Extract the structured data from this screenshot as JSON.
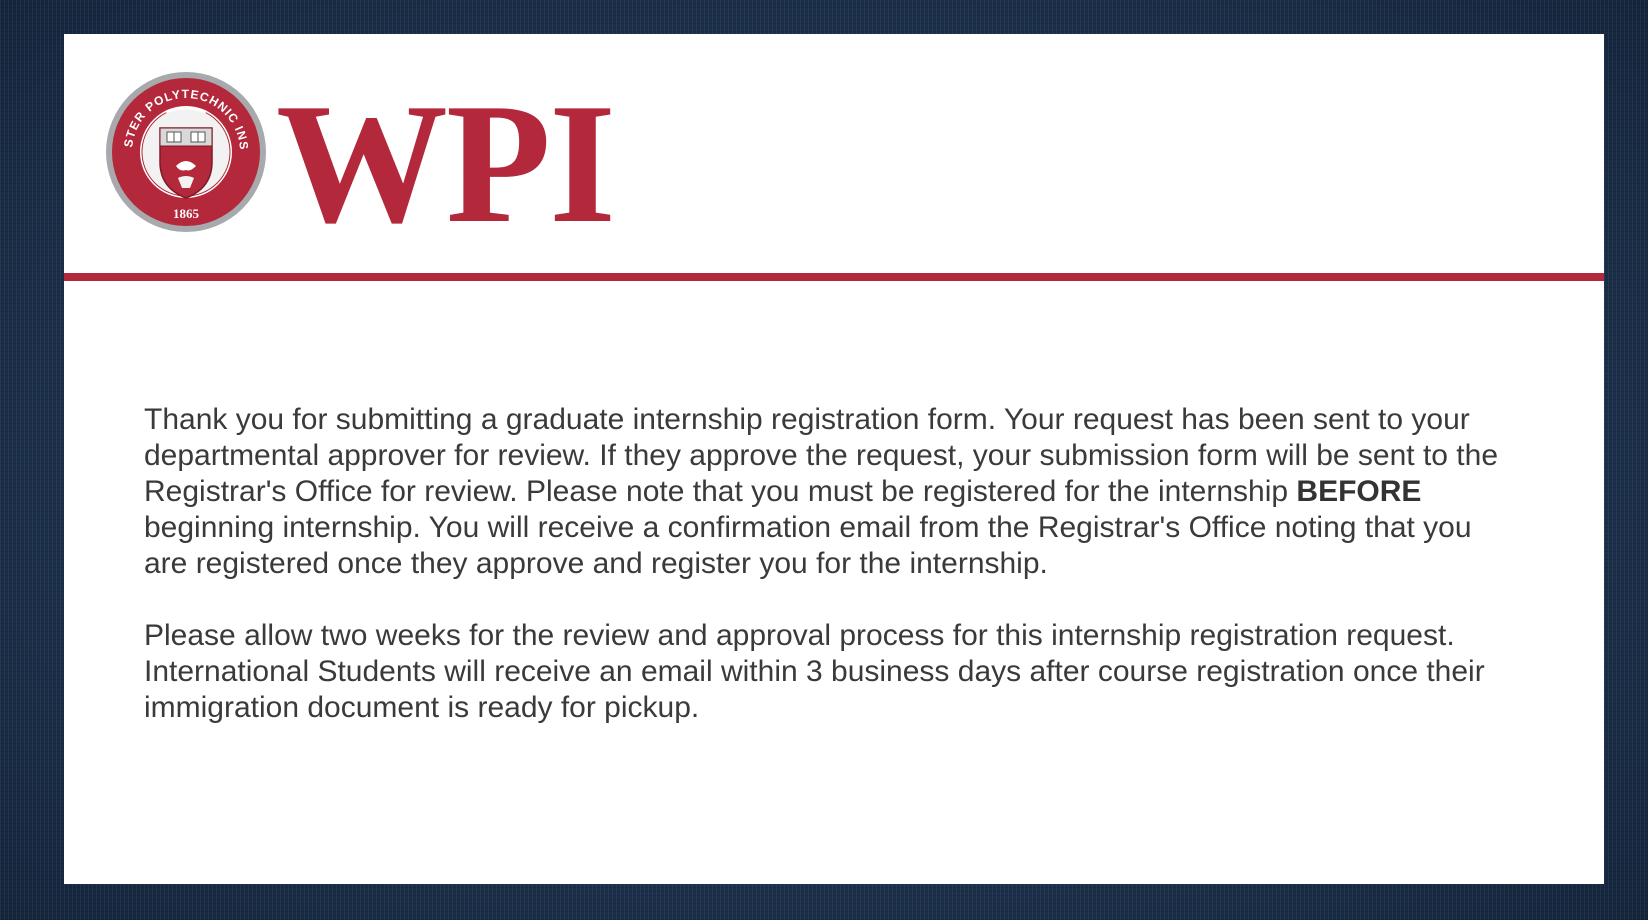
{
  "brand": {
    "wordmark": "WPI",
    "seal_top_text": "POLYTECHNIC",
    "seal_left_text": "WORCESTER",
    "seal_right_text": "INSTITUTE",
    "seal_year": "1865",
    "color_primary": "#b3283a",
    "color_seal_gray": "#a7a9ac"
  },
  "message": {
    "p1_part1": "Thank you for submitting a graduate internship registration form. Your request has been sent to your departmental approver for review. If they approve the request, your submission form will be sent to the Registrar's Office for review. Please note that you must be registered for the internship ",
    "p1_bold": "BEFORE",
    "p1_part2": " beginning internship. You will receive a confirmation email from the Registrar's Office noting that you are registered once they approve and register you for the internship.",
    "p2": "Please allow two weeks for the review and approval process for this internship registration request. International Students will receive an email within 3 business days after course registration once their immigration document is ready for pickup."
  }
}
